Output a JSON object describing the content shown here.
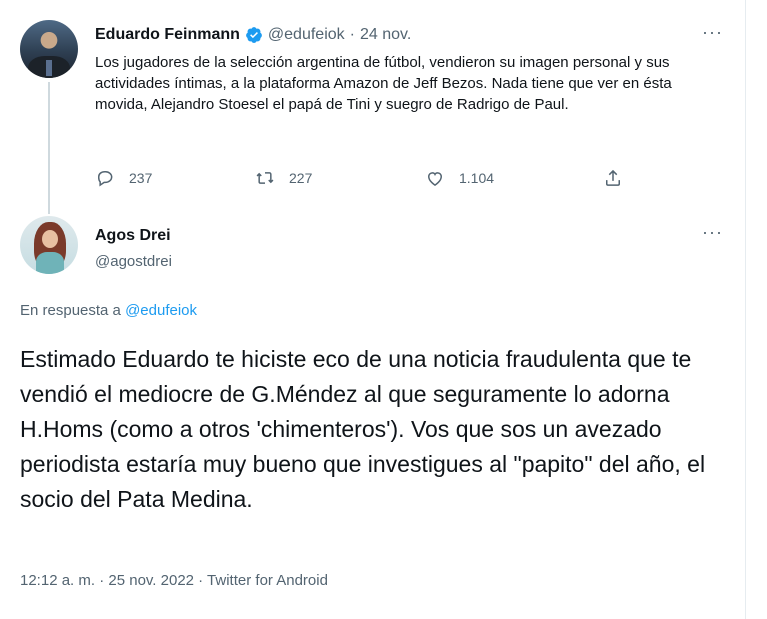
{
  "parent_tweet": {
    "display_name": "Eduardo Feinmann",
    "handle": "@edufeiok",
    "separator": "·",
    "date": "24 nov.",
    "more": "···",
    "text": "Los jugadores de la selección argentina de fútbol, vendieron su imagen personal y sus actividades íntimas, a la plataforma Amazon de Jeff Bezos. Nada tiene que ver en ésta movida, Alejandro Stoesel el papá de Tini y suegro de Radrigo de Paul.",
    "replies": "237",
    "retweets": "227",
    "likes": "1.104",
    "verified_icon": "verified-badge-icon"
  },
  "reply_tweet": {
    "display_name": "Agos Drei",
    "handle": "@agostdrei",
    "more": "···",
    "in_reply_label": "En respuesta a",
    "in_reply_mention": "@edufeiok",
    "text": "Estimado Eduardo te hiciste eco de una noticia fraudulenta que te vendió el mediocre de G.Méndez al que seguramente lo adorna H.Homs (como a otros 'chimenteros'). Vos que sos un avezado periodista estaría muy bueno que investigues al \"papito\" del año, el socio del Pata Medina.",
    "meta": "12:12 a. m. · 25 nov. 2022 · Twitter for Android"
  },
  "colors": {
    "accent": "#1d9bf0",
    "muted": "#536471",
    "text": "#0f1419"
  }
}
